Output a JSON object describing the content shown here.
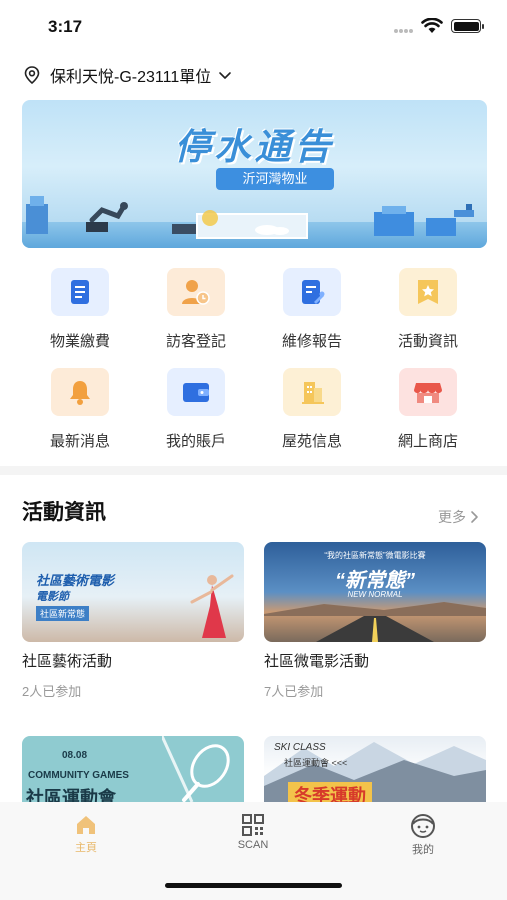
{
  "status": {
    "time": "3:17"
  },
  "location": {
    "label": "保利天悅-G-23111單位"
  },
  "banner": {
    "title": "停水通告",
    "subtitle": "沂河灣物业"
  },
  "grid": [
    {
      "label": "物業繳費",
      "icon": "bill-icon"
    },
    {
      "label": "訪客登記",
      "icon": "visitor-icon"
    },
    {
      "label": "維修報告",
      "icon": "repair-icon"
    },
    {
      "label": "活動資訊",
      "icon": "event-icon"
    },
    {
      "label": "最新消息",
      "icon": "bell-icon"
    },
    {
      "label": "我的賬戶",
      "icon": "wallet-icon"
    },
    {
      "label": "屋苑信息",
      "icon": "building-icon"
    },
    {
      "label": "網上商店",
      "icon": "store-icon"
    }
  ],
  "activities": {
    "title": "活動資訊",
    "more": "更多",
    "cards": [
      {
        "title": "社區藝術活動",
        "sub": "2人已参加",
        "img_title": "社區藝術電影",
        "img_title2": "電影節",
        "img_tag": "社區新常態"
      },
      {
        "title": "社區微電影活動",
        "sub": "7人已参加",
        "img_top": "“我的社區新常態”微電影比賽",
        "img_title": "“新常態”",
        "img_sub": "NEW NORMAL"
      },
      {
        "img_date": "08.08",
        "img_sub": "COMMUNITY GAMES",
        "img_title": "社區運動會"
      },
      {
        "img_top": "SKI CLASS",
        "img_sub": "社區運動會 <<<",
        "img_title": "冬季運動"
      }
    ]
  },
  "tabs": [
    {
      "label": "主頁",
      "icon": "home-icon"
    },
    {
      "label": "SCAN",
      "icon": "qr-icon"
    },
    {
      "label": "我的",
      "icon": "profile-icon"
    }
  ],
  "colors": {
    "accent": "#e8b86a",
    "primary_blue": "#3a8fd8"
  }
}
